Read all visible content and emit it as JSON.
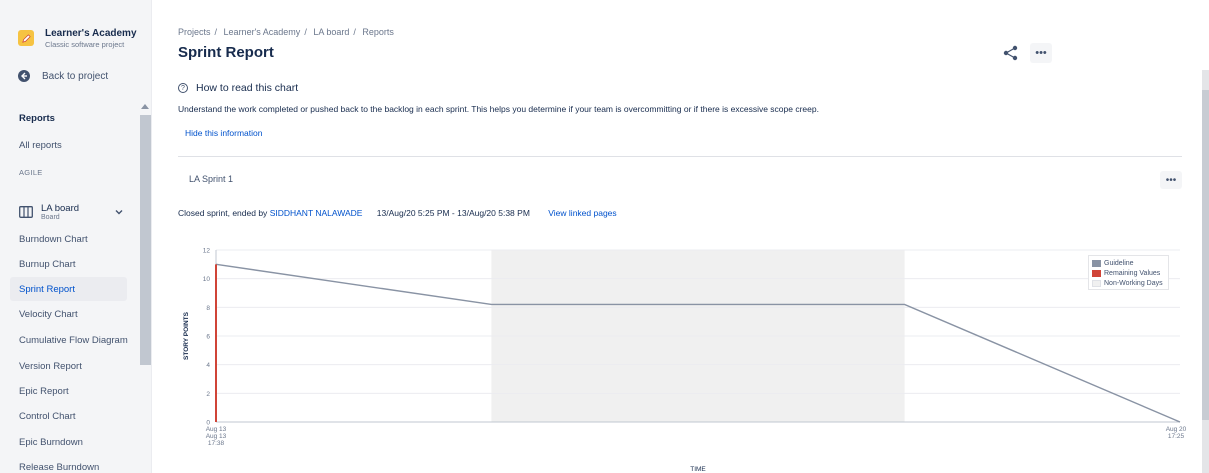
{
  "sidebar": {
    "project_name": "Learner's Academy",
    "project_type": "Classic software project",
    "back_label": "Back to project",
    "reports_heading": "Reports",
    "all_reports": "All reports",
    "agile_label": "AGILE",
    "board_name": "LA board",
    "board_sub": "Board",
    "items": [
      {
        "label": "Burndown Chart"
      },
      {
        "label": "Burnup Chart"
      },
      {
        "label": "Sprint Report",
        "active": true
      },
      {
        "label": "Velocity Chart"
      },
      {
        "label": "Cumulative Flow Diagram"
      },
      {
        "label": "Version Report"
      },
      {
        "label": "Epic Report"
      },
      {
        "label": "Control Chart"
      },
      {
        "label": "Epic Burndown"
      },
      {
        "label": "Release Burndown"
      }
    ]
  },
  "header": {
    "breadcrumb": [
      "Projects",
      "Learner's Academy",
      "LA board",
      "Reports"
    ],
    "title": "Sprint Report",
    "more_label": "•••"
  },
  "info": {
    "how_label": "How to read this chart",
    "how_icon": "?",
    "description": "Understand the work completed or pushed back to the backlog in each sprint. This helps you determine if your team is overcommitting or if there is excessive scope creep.",
    "hide_label": "Hide this information"
  },
  "sprint": {
    "name": "LA Sprint 1",
    "more_label": "•••",
    "closed_prefix": "Closed sprint, ended by",
    "user": "SIDDHANT NALAWADE",
    "dates": "13/Aug/20 5:25 PM - 13/Aug/20 5:38 PM",
    "linked_label": "View linked pages"
  },
  "chart_data": {
    "type": "line",
    "ylabel": "STORY POINTS",
    "xlabel": "TIME",
    "ylim": [
      0,
      12
    ],
    "yticks": [
      "0",
      "2",
      "4",
      "6",
      "8",
      "10",
      "12"
    ],
    "x_start_label": [
      "Aug 13",
      "17:25"
    ],
    "x_overlap_label": [
      "Aug 13",
      "17:38"
    ],
    "x_end_label": [
      "Aug 20",
      "17:25"
    ],
    "x_range_days": [
      0,
      7
    ],
    "non_working_range_days": [
      2,
      5
    ],
    "guideline": {
      "name": "Guideline",
      "color": "#8993a4",
      "points": [
        [
          0,
          11
        ],
        [
          2,
          8.2
        ],
        [
          5,
          8.2
        ],
        [
          7,
          0
        ]
      ]
    },
    "remaining": {
      "name": "Remaining Values",
      "color": "#d04437",
      "points": [
        [
          0,
          11
        ],
        [
          0,
          0
        ]
      ]
    },
    "legend": [
      {
        "label": "Guideline",
        "color": "#8993a4"
      },
      {
        "label": "Remaining Values",
        "color": "#d04437"
      },
      {
        "label": "Non-Working Days",
        "color": "#f0f0f0"
      }
    ],
    "legend_position": "top-right",
    "grid": true
  }
}
